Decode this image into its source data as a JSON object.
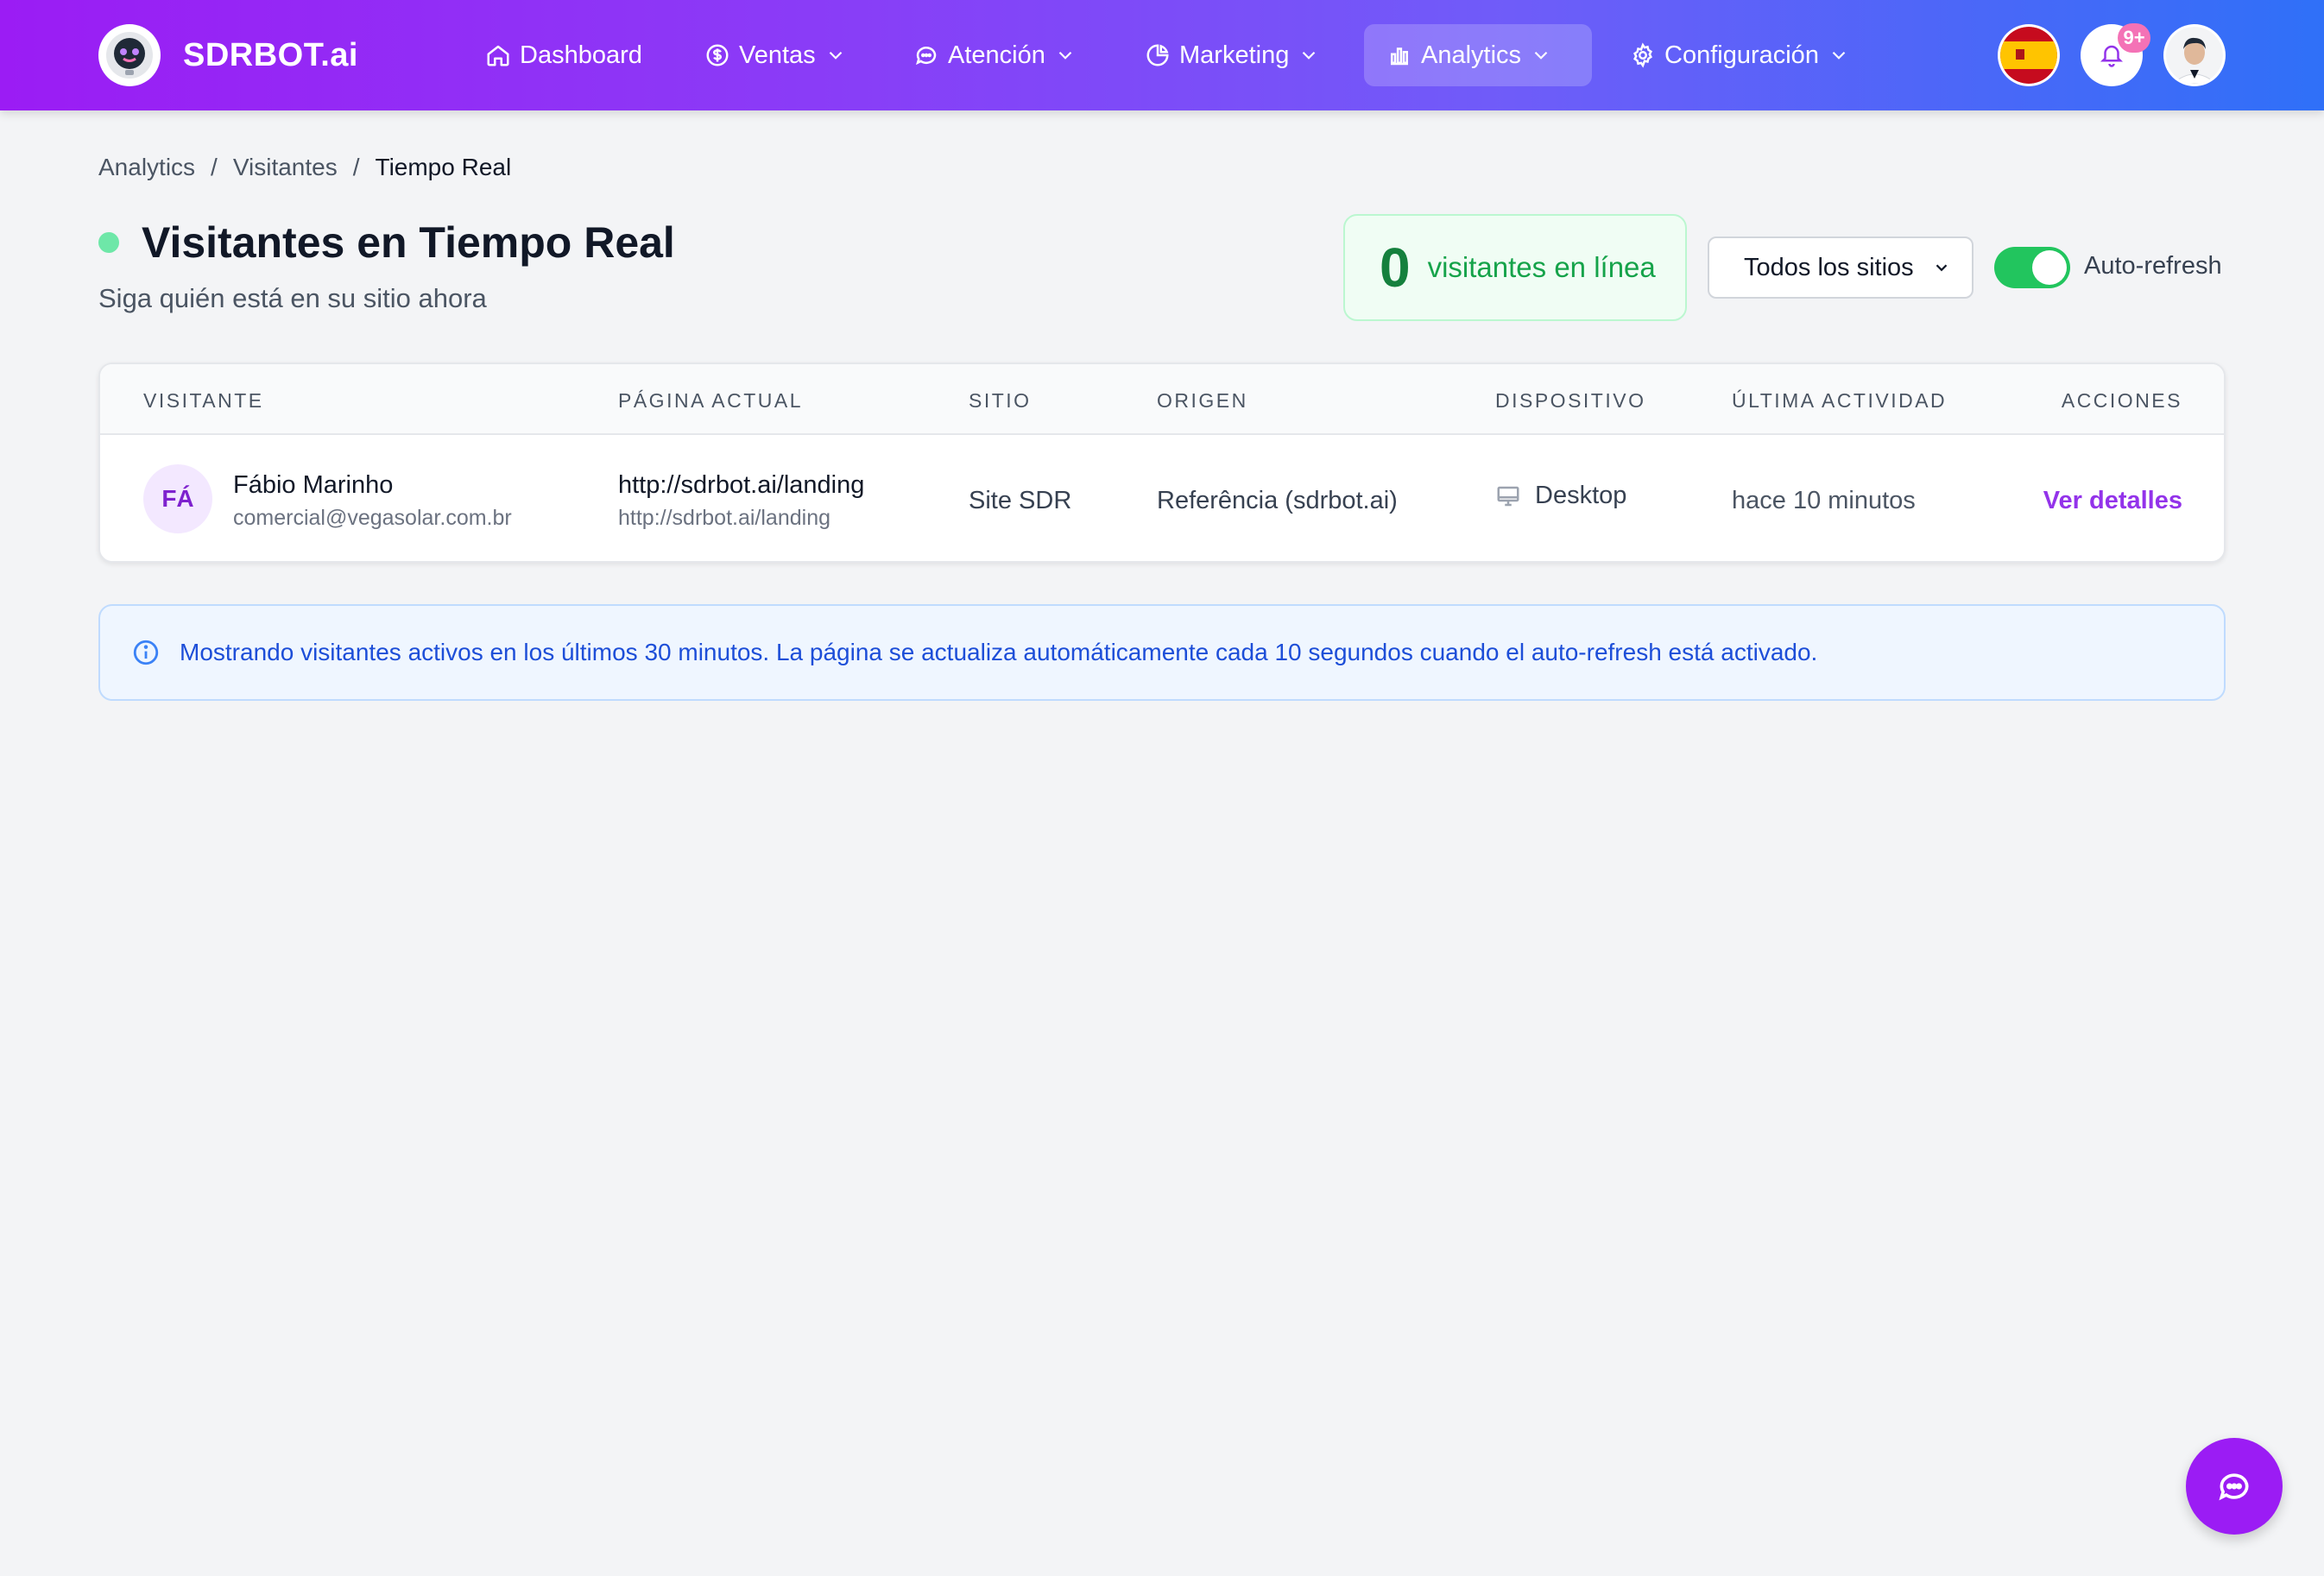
{
  "brand": {
    "name": "SDRBOT.ai"
  },
  "nav": {
    "items": [
      {
        "label": "Dashboard",
        "icon": "home-icon",
        "has_dropdown": false
      },
      {
        "label": "Ventas",
        "icon": "dollar-icon",
        "has_dropdown": true
      },
      {
        "label": "Atención",
        "icon": "chat-bubble-icon",
        "has_dropdown": true
      },
      {
        "label": "Marketing",
        "icon": "pie-chart-icon",
        "has_dropdown": true
      },
      {
        "label": "Analytics",
        "icon": "bar-chart-icon",
        "has_dropdown": true,
        "active": true
      },
      {
        "label": "Configuración",
        "icon": "gear-icon",
        "has_dropdown": true
      }
    ],
    "notifications_badge": "9+"
  },
  "breadcrumb": [
    "Analytics",
    "Visitantes",
    "Tiempo Real"
  ],
  "page": {
    "title": "Visitantes en Tiempo Real",
    "subtitle": "Siga quién está en su sitio ahora"
  },
  "counter": {
    "value": "0",
    "label": "visitantes en línea"
  },
  "site_filter": {
    "selected": "Todos los sitios"
  },
  "auto_refresh": {
    "label": "Auto-refresh",
    "enabled": true
  },
  "table": {
    "headers": [
      "VISITANTE",
      "PÁGINA ACTUAL",
      "SITIO",
      "ORIGEN",
      "DISPOSITIVO",
      "ÚLTIMA ACTIVIDAD",
      "ACCIONES"
    ],
    "rows": [
      {
        "initials": "FÁ",
        "name": "Fábio Marinho",
        "email": "comercial@vegasolar.com.br",
        "page_title": "http://sdrbot.ai/landing",
        "page_url": "http://sdrbot.ai/landing",
        "site": "Site SDR",
        "origin": "Referência (sdrbot.ai)",
        "device": "Desktop",
        "last_activity": "hace 10 minutos",
        "action": "Ver detalles"
      }
    ]
  },
  "info": {
    "text": "Mostrando visitantes activos en los últimos 30 minutos. La página se actualiza automáticamente cada 10 segundos cuando el auto-refresh está activado."
  },
  "colors": {
    "brand_gradient_start": "#9b1cf4",
    "brand_gradient_end": "#2f70f8",
    "accent_purple": "#9333ea",
    "success_green": "#22c55e",
    "info_blue": "#1d4ed8"
  }
}
